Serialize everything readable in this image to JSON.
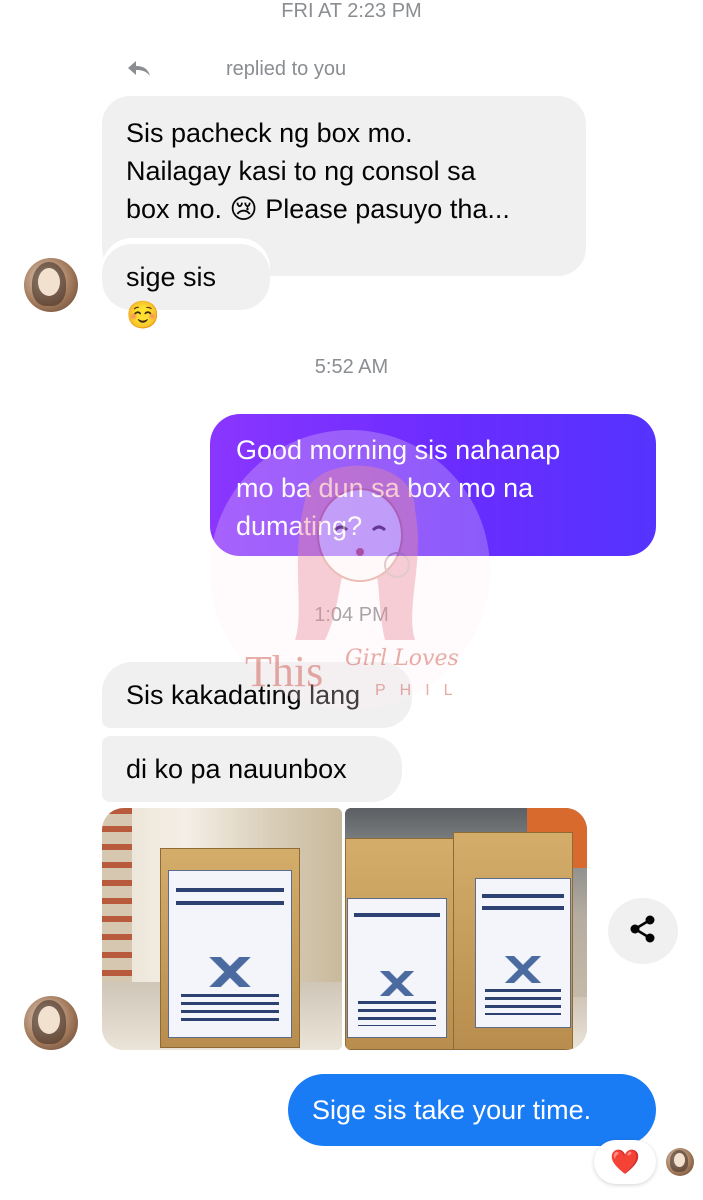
{
  "timestamps": {
    "first": "FRI AT 2:23 PM",
    "second": "5:52 AM",
    "third": "1:04 PM"
  },
  "reply_indicator": {
    "text": "replied to you",
    "icon": "reply-arrow-icon"
  },
  "messages": {
    "quoted": {
      "lines": [
        "Sis pacheck ng box mo.",
        "Nailagay kasi to ng consol sa",
        "box mo. 😢 Please pasuyo tha..."
      ]
    },
    "reply": "sige sis ☺️",
    "outgoing_1": {
      "lines": [
        "Good morning sis nahanap",
        "mo ba dun sa box mo na",
        "dumating?"
      ]
    },
    "incoming_1": "Sis kakadating lang",
    "incoming_2": "di ko pa nauunbox",
    "outgoing_2": "Sige sis take your time."
  },
  "attachments": [
    "photo",
    "photo"
  ],
  "actions": {
    "share_icon": "share-icon"
  },
  "reaction": {
    "emoji": "❤️"
  },
  "watermark": {
    "title": "This",
    "script": "Girl Loves",
    "sub": "PHIL"
  },
  "colors": {
    "incoming_bubble": "#f0f0f0",
    "outgoing_gradient_start": "#8a36ff",
    "outgoing_gradient_end": "#5533ff",
    "outgoing_blue": "#1a7cf5",
    "timestamp": "#8a8d91"
  }
}
